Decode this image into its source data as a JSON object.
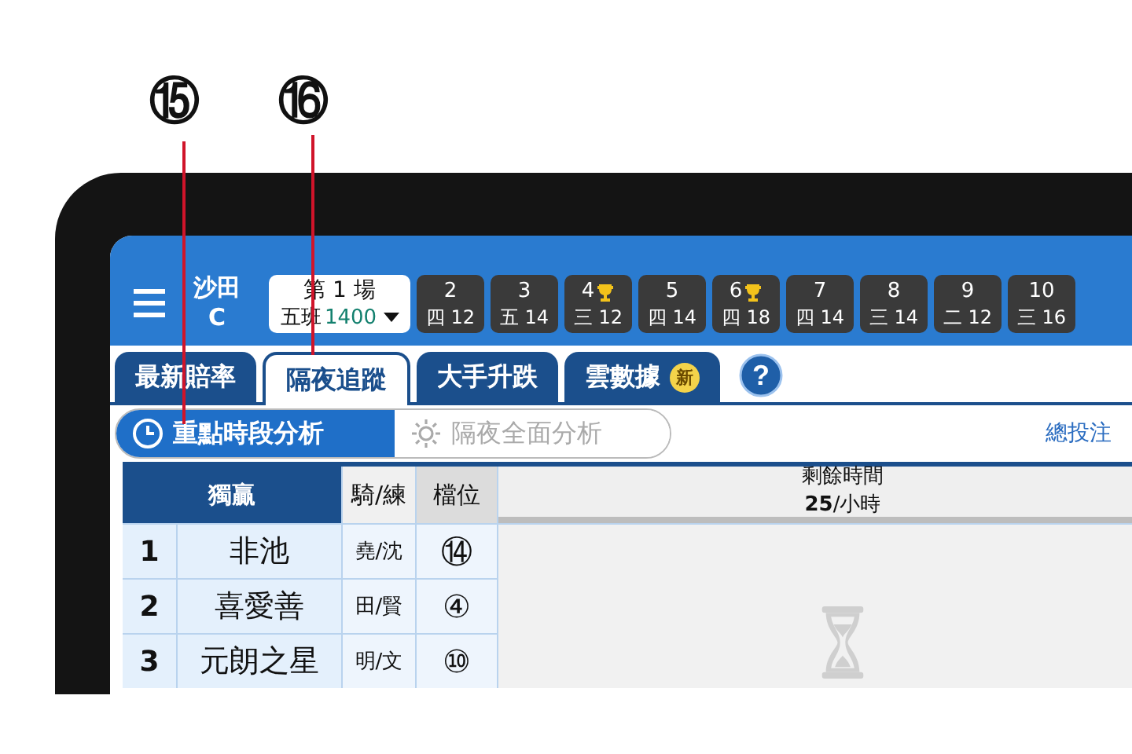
{
  "callouts": [
    {
      "label": "⑮"
    },
    {
      "label": "⑯"
    }
  ],
  "header": {
    "venue": "沙田",
    "track": "C",
    "race_selector": {
      "race": "第 1 場",
      "class": "五班",
      "distance": "1400"
    },
    "races": [
      {
        "number": "2",
        "class": "四",
        "runners": "12",
        "trophy": false
      },
      {
        "number": "3",
        "class": "五",
        "runners": "14",
        "trophy": false
      },
      {
        "number": "4",
        "class": "三",
        "runners": "12",
        "trophy": true
      },
      {
        "number": "5",
        "class": "四",
        "runners": "14",
        "trophy": false
      },
      {
        "number": "6",
        "class": "四",
        "runners": "18",
        "trophy": true
      },
      {
        "number": "7",
        "class": "四",
        "runners": "14",
        "trophy": false
      },
      {
        "number": "8",
        "class": "三",
        "runners": "14",
        "trophy": false
      },
      {
        "number": "9",
        "class": "二",
        "runners": "12",
        "trophy": false
      },
      {
        "number": "10",
        "class": "三",
        "runners": "16",
        "trophy": false
      }
    ]
  },
  "tabs": [
    {
      "label": "最新賠率",
      "selected": false
    },
    {
      "label": "隔夜追蹤",
      "selected": true
    },
    {
      "label": "大手升跌",
      "selected": false
    },
    {
      "label": "雲數據",
      "selected": false,
      "badge": "新"
    }
  ],
  "segments": [
    {
      "label": "重點時段分析",
      "kind": "clock",
      "selected": true
    },
    {
      "label": "隔夜全面分析",
      "kind": "sun",
      "selected": false
    }
  ],
  "help": "?",
  "total_link": "總投注",
  "table": {
    "columns": [
      "獨贏",
      "騎/練",
      "檔位"
    ],
    "remaining_label": "剩餘時間",
    "remaining_value": "25",
    "remaining_unit": "/小時",
    "rows": [
      {
        "number": "1",
        "horse": "非池",
        "jockey_trainer": "堯/沈",
        "draw": "⑭"
      },
      {
        "number": "2",
        "horse": "喜愛善",
        "jockey_trainer": "田/賢",
        "draw": "④"
      },
      {
        "number": "3",
        "horse": "元朗之星",
        "jockey_trainer": "明/文",
        "draw": "⑩"
      }
    ]
  }
}
